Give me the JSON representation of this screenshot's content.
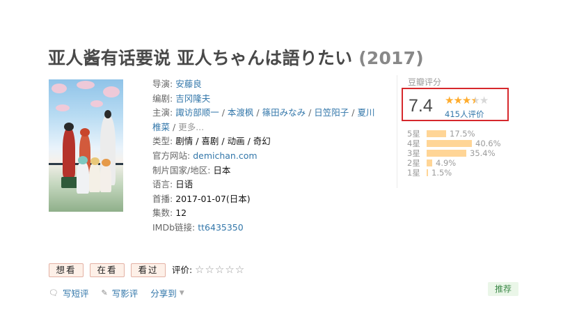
{
  "title": {
    "main": "亚人酱有话要说 亚人ちゃんは語りたい",
    "year": "(2017)"
  },
  "info": {
    "director_label": "导演",
    "director": "安藤良",
    "writer_label": "编剧",
    "writer": "吉冈隆夫",
    "cast_label": "主演",
    "cast": [
      "諏访部顺一",
      "本渡枫",
      "篠田みなみ",
      "日笠阳子",
      "夏川"
    ],
    "cast_cont": "椎菜",
    "more": "更多...",
    "genre_label": "类型",
    "genres": [
      "剧情",
      "喜剧",
      "动画",
      "奇幻"
    ],
    "site_label": "官方网站:",
    "site": "demichan.com",
    "country_label": "制片国家/地区:",
    "country": "日本",
    "lang_label": "语言:",
    "lang": "日语",
    "premiere_label": "首播:",
    "premiere": "2017-01-07(日本)",
    "episodes_label": "集数:",
    "episodes": "12",
    "imdb_label": "IMDb链接:",
    "imdb": "tt6435350"
  },
  "rating": {
    "label": "豆瓣评分",
    "score": "7.4",
    "stars_filled": 3.5,
    "votes": "415人评价",
    "distribution": [
      {
        "label": "5星",
        "pct": "17.5%",
        "value": 17.5
      },
      {
        "label": "4星",
        "pct": "40.6%",
        "value": 40.6
      },
      {
        "label": "3星",
        "pct": "35.4%",
        "value": 35.4
      },
      {
        "label": "2星",
        "pct": "4.9%",
        "value": 4.9
      },
      {
        "label": "1星",
        "pct": "1.5%",
        "value": 1.5
      }
    ],
    "color_stars": "#ffac2d",
    "color_bars": "#ffd596",
    "color_highlight_box": "#d6282c"
  },
  "buttons": {
    "wish": "想看",
    "doing": "在看",
    "done": "看过"
  },
  "user_rating": {
    "label": "评价:",
    "stars": "☆☆☆☆☆"
  },
  "actions": {
    "short_review": "写短评",
    "review": "写影评",
    "share": "分享到"
  },
  "recommend": "推荐"
}
